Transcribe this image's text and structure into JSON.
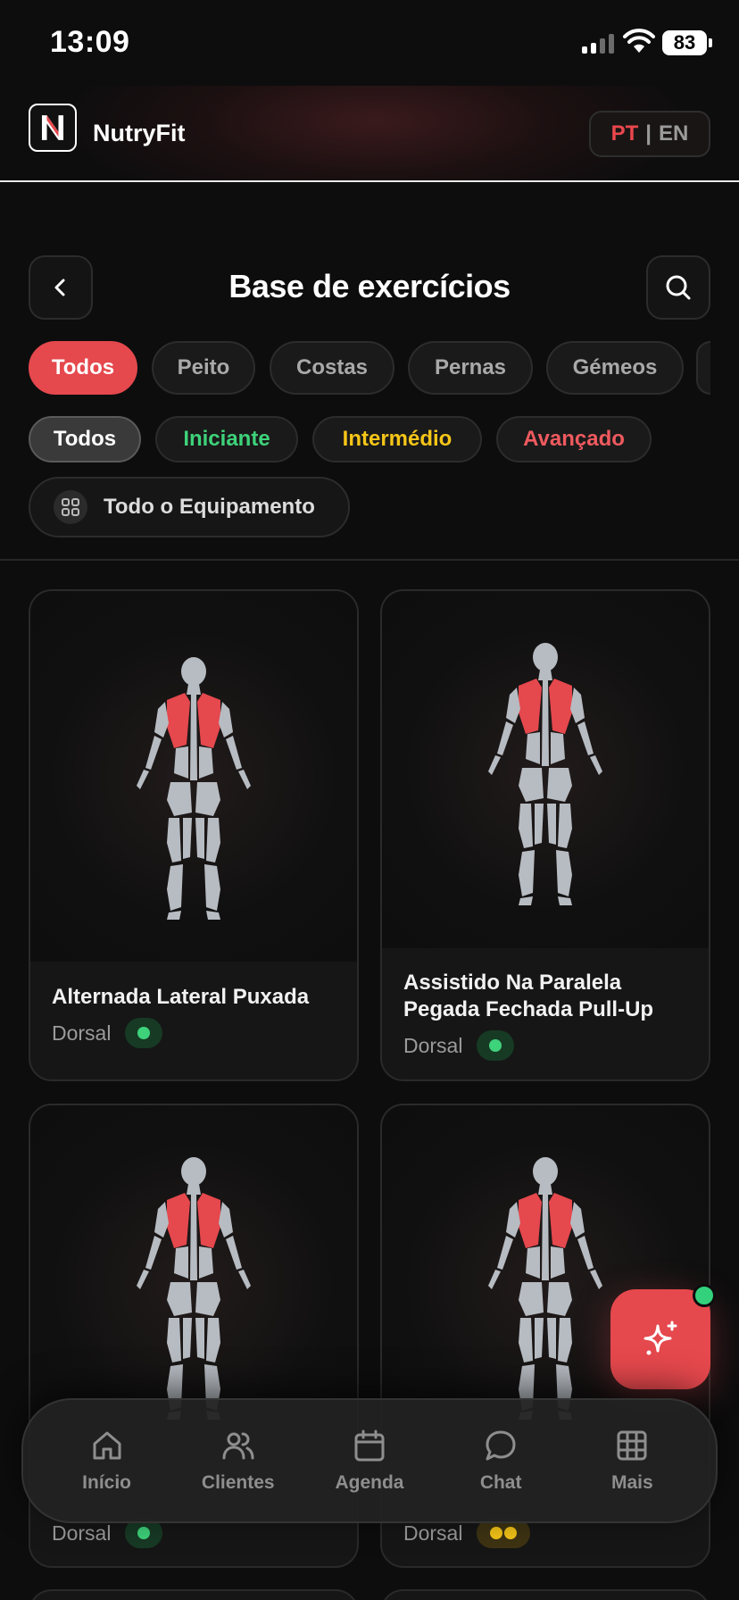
{
  "status_bar": {
    "time": "13:09",
    "battery": "83"
  },
  "header": {
    "brand": "NutryFit",
    "lang_pt": "PT",
    "lang_sep": "|",
    "lang_en": "EN"
  },
  "page": {
    "title": "Base de exercícios"
  },
  "muscle_filters": [
    {
      "label": "Todos",
      "active": true
    },
    {
      "label": "Peito"
    },
    {
      "label": "Costas"
    },
    {
      "label": "Pernas"
    },
    {
      "label": "Gémeos"
    }
  ],
  "level_filters": [
    {
      "label": "Todos",
      "active": true
    },
    {
      "label": "Iniciante",
      "color": "#3ed27a"
    },
    {
      "label": "Intermédio",
      "color": "#f5c518"
    },
    {
      "label": "Avançado",
      "color": "#ef5a5f"
    }
  ],
  "equipment_filter": {
    "label": "Todo o Equipamento"
  },
  "exercises": [
    {
      "name": "Alternada Lateral Puxada",
      "muscle": "Dorsal",
      "level": "Iniciante"
    },
    {
      "name": "Assistido Na Paralela Pegada Fechada Pull-Up",
      "muscle": "Dorsal",
      "level": "Iniciante"
    },
    {
      "name": "",
      "muscle": "Dorsal",
      "level": "Iniciante"
    },
    {
      "name": "",
      "muscle": "Dorsal",
      "level": "Intermédio"
    }
  ],
  "bottom_nav": [
    {
      "label": "Início",
      "icon": "home-icon"
    },
    {
      "label": "Clientes",
      "icon": "users-icon"
    },
    {
      "label": "Agenda",
      "icon": "calendar-icon"
    },
    {
      "label": "Chat",
      "icon": "chat-icon"
    },
    {
      "label": "Mais",
      "icon": "grid-icon"
    }
  ],
  "colors": {
    "accent": "#e5484d",
    "beginner": "#3ed27a",
    "intermediate": "#f5c518",
    "advanced": "#ef5a5f",
    "background": "#0d0d0e"
  }
}
